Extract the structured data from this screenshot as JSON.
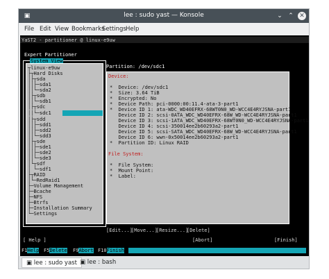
{
  "window": {
    "title": "lee : sudo yast — Konsole",
    "icons": [
      "terminal-app-icon",
      "chevron-down-icon",
      "chevron-up-icon",
      "close-icon"
    ]
  },
  "menubar": [
    "File",
    "Edit",
    "View",
    "Bookmarks",
    "Settings",
    "Help"
  ],
  "yast": {
    "header": "YaST2 - partitioner @ linux-e9uw",
    "section": "Expert Partitioner",
    "tree_title": "System View",
    "tree": [
      "linux-e9uw",
      "Hard Disks",
      "sda",
      "sda1",
      "sda2",
      "sdb",
      "sdb1",
      "sdc",
      "sdc1",
      "sdd",
      "sdd1",
      "sdd2",
      "sdd3",
      "sde",
      "sde1",
      "sde2",
      "sde3",
      "sdf",
      "sdf1",
      "RAID",
      "RedRaid1",
      "Volume Management",
      "Bcache",
      "NFS",
      "Btrfs",
      "Installation Summary",
      "Settings"
    ],
    "selected_tree_item": "sdc1",
    "partition_label": "Partition: /dev/sdc1",
    "device_heading": "Device:",
    "device_lines": [
      "*  Device: /dev/sdc1",
      "*  Size: 3.64 TiB",
      "*  Encrypted: No",
      "*  Device Path: pci-0000:00:11.4-ata-3-part1",
      "*  Device ID 1: ata-WDC_WD40EFRX-68WT0N0_WD-WCC4E4RYJSNA-part1",
      "   Device ID 2: scsi-0ATA_WDC_WD40EFRX-68W_WD-WCC4E4RYJSNA-part1",
      "   Device ID 3: scsi-1ATA_WDC_WD40EFRX-68WT0N0_WD-WCC4E4RYJSNA-part1",
      "   Device ID 4: scsi-350014ee2b60293a2-part1",
      "   Device ID 5: scsi-SATA_WDC_WD40EFRX-68W_WD-WCC4E4RYJSNA-part1",
      "   Device ID 6: wwn-0x50014ee2b60293a2-part1",
      "*  Partition ID: Linux RAID"
    ],
    "fs_heading": "File System:",
    "fs_lines": [
      "*  File System:",
      "*  Mount Point:",
      "*  Label:"
    ],
    "action_buttons": [
      "[Edit...]",
      "[Move...]",
      "[Resize...]",
      "[Delete]"
    ],
    "help_button": "[ Help ]",
    "abort_button": "[Abort]",
    "finish_button": "[Finish]",
    "fkeys": [
      {
        "key": "F1",
        "label": "Help"
      },
      {
        "key": "F5",
        "label": "Delete"
      },
      {
        "key": "F9",
        "label": "Abort"
      },
      {
        "key": "F10",
        "label": "Finish"
      }
    ]
  },
  "tabs": [
    {
      "label": "lee : sudo yast",
      "active": true
    },
    {
      "label": "lee : bash",
      "active": false
    }
  ],
  "colors": {
    "accent": "#14a5b5",
    "terminal_bg": "#000000",
    "panel_bg": "#c0c0c0",
    "heading_red": "#c01c1c",
    "titlebar": "#475057"
  }
}
